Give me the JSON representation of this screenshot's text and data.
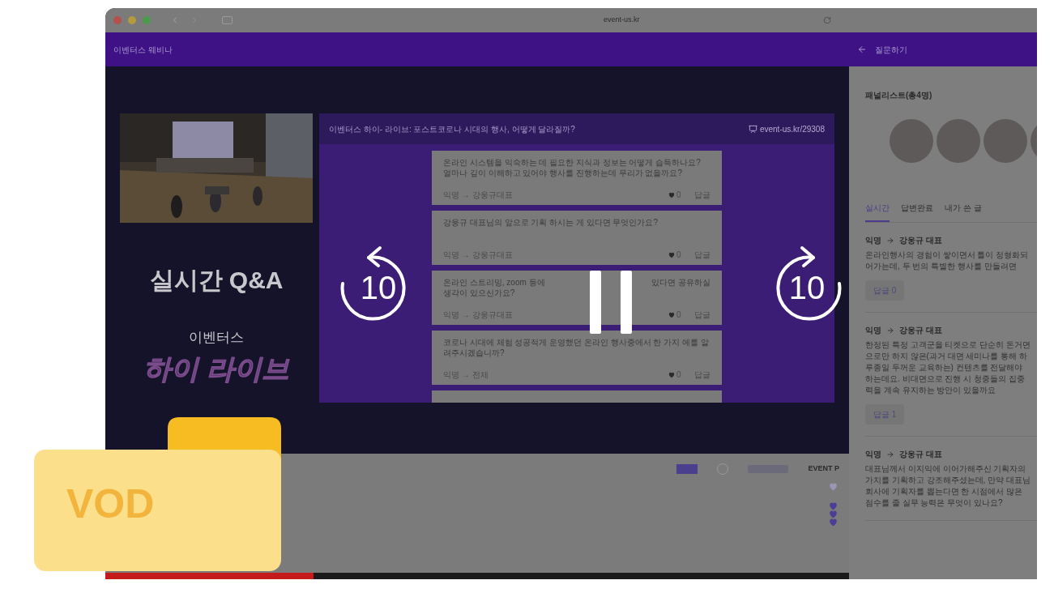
{
  "browser": {
    "url": "event-us.kr"
  },
  "header": {
    "title": "이벤터스 웨비나",
    "panel_title": "질문하기"
  },
  "stage": {
    "heading": "실시간 Q&A",
    "brand_small": "이벤터스",
    "brand_large": "하이 라이브"
  },
  "slide": {
    "title": "이벤터스 하이- 라이브: 포스트코로나 시대의 행사, 어떻게 달라질까?",
    "link": "event-us.kr/29308",
    "questions": [
      {
        "text": "온라인 시스템을 익숙하는 데 필요한 지식과 정보는 어떻게 습득하나요? 얼마나 깊이 이해하고 있어야 행사를 진행하는데 무리가 없을까요?",
        "author": "익명 → 강웅규대표",
        "likes": "0",
        "reply": "답글"
      },
      {
        "text": "강웅규 대표님의 앞으로 기획 하시는 게 있다면 무엇인가요?",
        "author": "익명 → 강웅규대표",
        "likes": "0",
        "reply": "답글"
      },
      {
        "kind": "covered",
        "text_left": "온라인 스트리밍, zoom 등에",
        "text_right": "있다면 공유하실",
        "text": "생각이 있으신가요?",
        "author": "익명 → 강웅규대표",
        "likes": "0",
        "reply": "답글"
      },
      {
        "text": "코로나 시대에 체험 성공적게 운영했던 온라인 행사중에서 한 가지 예를 알려주시겠습니까?",
        "author": "익명 → 전체",
        "likes": "0",
        "reply": "답글"
      }
    ]
  },
  "sponsors": {
    "text_logo": "EVENT P"
  },
  "player": {
    "paused": true,
    "skip_back": "10",
    "skip_forward": "10",
    "progress": {
      "level": 0.28
    }
  },
  "panel": {
    "panelists_title": "패널리스트(총4명)",
    "tabs": [
      {
        "label": "실시간",
        "selected": true
      },
      {
        "label": "답변완료",
        "selected": false
      },
      {
        "label": "내가 쓴 글",
        "selected": false
      }
    ],
    "comments": [
      {
        "author": "익명",
        "target": "강웅규 대표",
        "text": "온라인행사의 경험이 쌓이면서 틀이 정형화되어가는데, 두 번의 특별한 행사를 만들려면",
        "reply": "답글 0"
      },
      {
        "author": "익명",
        "target": "강웅규 대표",
        "text": "한정된 특정 고객군을 티켓으로 단순히 돈거면으로만 하지 않은(과거 대면 세미나를 통해 하루종일 두꺼운 교육하는) 컨텐츠를 전달해야 하는데요. 비대면으로 진행 시 청중들의 집중력을 계속 유지하는 방안이 있을까요",
        "reply": "답글 1"
      },
      {
        "author": "익명",
        "target": "강웅규 대표",
        "text": "대표님께서 이지익에 이어가해주신 기획자의 가치를 기획하고 강조해주셨는데, 만약 대표님 회사에 기획자를 뽑는다면 한 시점에서 많은 점수를 줄 실무 능력은 무엇이 있나요?"
      }
    ]
  },
  "badge": {
    "label": "VOD"
  }
}
